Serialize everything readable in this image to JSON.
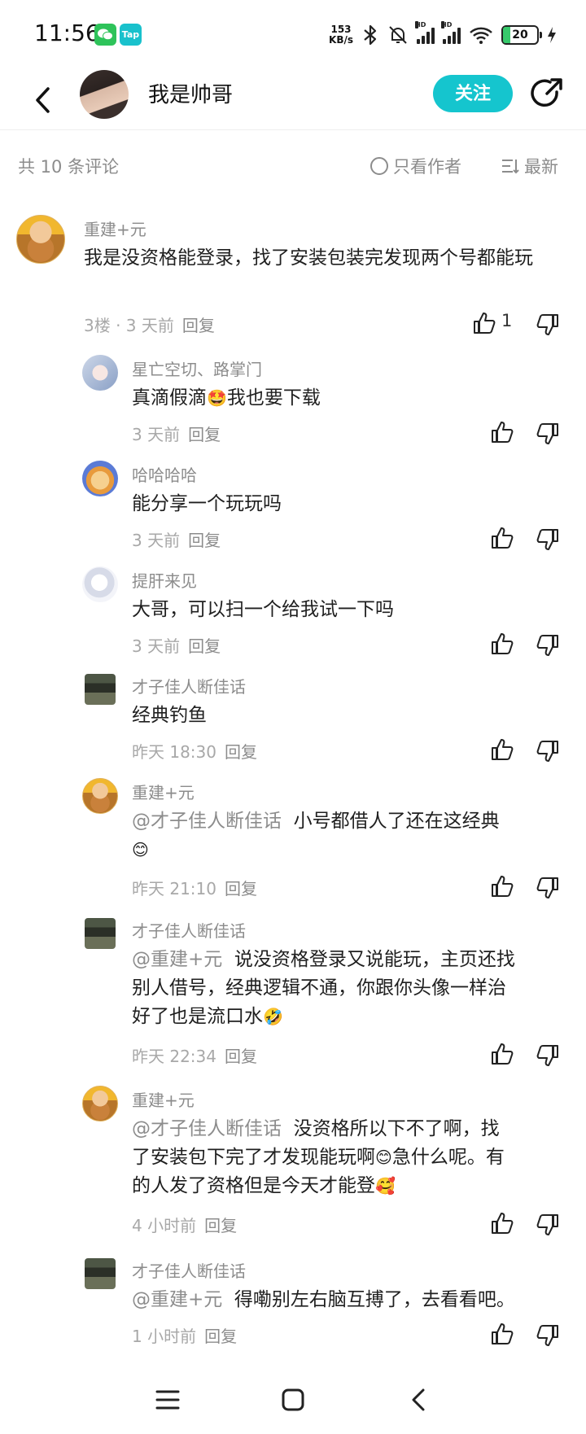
{
  "status_bar": {
    "time": "11:56",
    "net_speed_value": "153",
    "net_speed_unit": "KB/s",
    "battery": "20",
    "app1": "",
    "app2": "Tap"
  },
  "header": {
    "title": "我是帅哥",
    "follow_label": "关注"
  },
  "filter": {
    "count": "共 10 条评论",
    "only_author": "只看作者",
    "sort": "最新"
  },
  "comments": [
    {
      "name": "重建+元",
      "text": "我是没资格能登录，找了安装包装完发现两个号都能玩",
      "meta": "3楼 · 3 天前",
      "reply": "回复",
      "likes": "1"
    },
    {
      "name": "星亡空切、路掌门",
      "text_a": "真滴假滴",
      "emoji": "🤩",
      "text_b": "我也要下载",
      "meta": "3 天前",
      "reply": "回复"
    },
    {
      "name": "哈哈哈哈",
      "text": "能分享一个玩玩吗",
      "meta": "3 天前",
      "reply": "回复"
    },
    {
      "name": "提肝来见",
      "text": "大哥，可以扫一个给我试一下吗",
      "meta": "3 天前",
      "reply": "回复"
    },
    {
      "name": "才子佳人断佳话",
      "text": "经典钓鱼",
      "meta": "昨天 18:30",
      "reply": "回复"
    },
    {
      "name": "重建+元",
      "mention": "@才子佳人断佳话",
      "text": "小号都借人了还在这经典",
      "emoji": "😊",
      "meta": "昨天 21:10",
      "reply": "回复"
    },
    {
      "name": "才子佳人断佳话",
      "mention": "@重建+元",
      "text_line1": "说没资格登录又说能玩，主页还找",
      "text_line2": "别人借号，经典逻辑不通，你跟你头像一样治",
      "text_line3": "好了也是流口水",
      "emoji": "🤣",
      "meta": "昨天 22:34",
      "reply": "回复"
    },
    {
      "name": "重建+元",
      "mention": "@才子佳人断佳话",
      "text_line1": "没资格所以下不了啊，找",
      "text_line2_a": "了安装包下完了才发现能玩啊",
      "emoji1": "😊",
      "text_line2_b": "急什么呢。有",
      "text_line3": "的人发了资格但是今天才能登",
      "emoji2": "🥰",
      "meta": "4 小时前",
      "reply": "回复"
    },
    {
      "name": "才子佳人断佳话",
      "mention": "@重建+元",
      "text": "得嘞别左右脑互搏了，去看看吧。",
      "meta": "1 小时前",
      "reply": "回复"
    }
  ],
  "nav": {
    "menu_icon": "menu-icon",
    "home_icon": "home-icon",
    "back_icon": "back-icon"
  }
}
